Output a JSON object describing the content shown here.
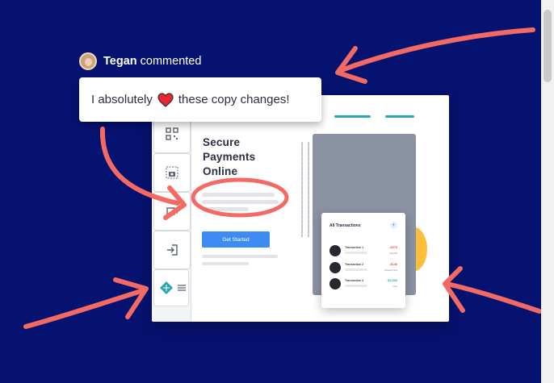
{
  "comment": {
    "author": "Tegan",
    "action": "commented",
    "text_before": "I absolutely",
    "text_after": "these copy changes!",
    "heart_icon": "heart-icon",
    "avatar_icon": "user-avatar"
  },
  "mockup": {
    "headline_lines": [
      "Secure",
      "Payments",
      "Online"
    ],
    "cta_label": "Get Started",
    "sidebar_icons": [
      "qr-code-icon",
      "camera-icon",
      "video-icon",
      "sign-in-icon",
      "netlify-logo-icon"
    ],
    "accent_color": "#3e8cf3"
  },
  "transactions": {
    "title": "All Transactions",
    "add_icon": "plus-icon",
    "rows": [
      {
        "name": "Transaction 1",
        "amount": "-$375",
        "source": "PayPal",
        "color": "#e0534f"
      },
      {
        "name": "Transaction 2",
        "amount": "-$146",
        "source": "MasterCard",
        "color": "#e0534f"
      },
      {
        "name": "Transaction 3",
        "amount": "-$2,000",
        "source": "Visa",
        "color": "#2aa6b5"
      }
    ]
  },
  "colors": {
    "background": "#06126f",
    "annotation": "#f36a65",
    "teal": "#2aa6b5",
    "yellow": "#fdbf3a"
  }
}
